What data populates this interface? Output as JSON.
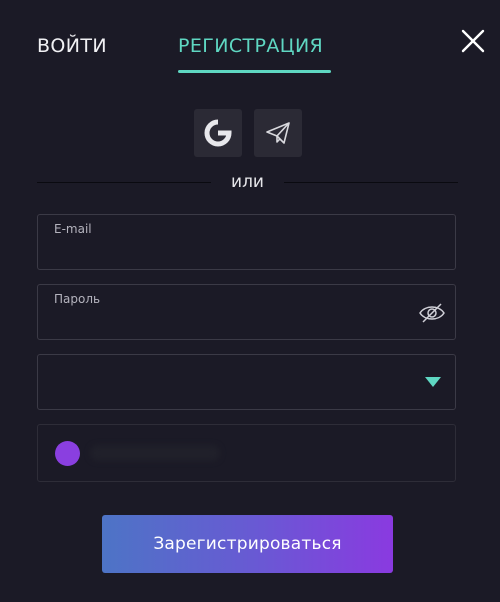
{
  "tabs": {
    "login": "ВОЙТИ",
    "register": "РЕГИСТРАЦИЯ",
    "active": "register"
  },
  "close_icon": "close-icon",
  "social": [
    {
      "name": "google",
      "icon": "google-icon"
    },
    {
      "name": "telegram",
      "icon": "telegram-icon"
    }
  ],
  "divider_text": "или",
  "fields": {
    "email": {
      "label": "E-mail",
      "value": ""
    },
    "password": {
      "label": "Пароль",
      "value": "",
      "icon": "eye-off-icon"
    },
    "currency_select": {
      "value": "",
      "icon": "chevron-down-icon"
    },
    "referral": {
      "icon": "avatar-dot"
    }
  },
  "submit_label": "Зарегистрироваться",
  "colors": {
    "background": "#1b1a26",
    "accent": "#5fd7c2",
    "field_border": "#3b3a46",
    "social_bg": "#2b2a35",
    "button_gradient_start": "#4d74c6",
    "button_gradient_end": "#8a3ae0",
    "referral_dot": "#8a3fe0"
  }
}
